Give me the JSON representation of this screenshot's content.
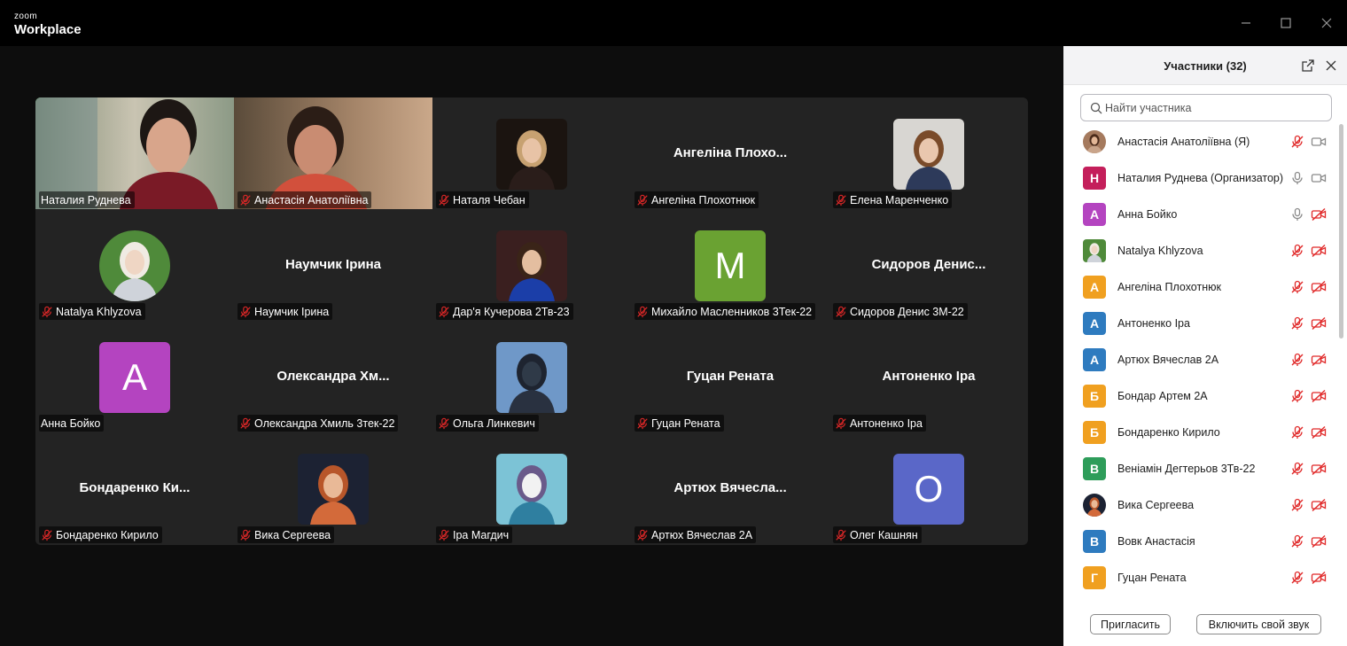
{
  "app": {
    "brand_small": "zoom",
    "brand_big": "Workplace"
  },
  "colors": {
    "active_speaker": "#23d959",
    "muted_red": "#e02828",
    "panel_bg": "#ffffff"
  },
  "tiles": [
    {
      "name": "Наталия Руднева",
      "kind": "video",
      "muted": false,
      "active": true
    },
    {
      "name": "Анастасія Анатоліївна",
      "kind": "video",
      "muted": true
    },
    {
      "name": "Наталя Чебан",
      "kind": "photo",
      "muted": true
    },
    {
      "name": "Ангеліна Плохотнюк",
      "kind": "text",
      "big": "Ангеліна  Плохо...",
      "muted": true
    },
    {
      "name": "Елена Маренченко",
      "kind": "photo",
      "muted": true
    },
    {
      "name": "Natalya Khlyzova",
      "kind": "photo",
      "muted": true
    },
    {
      "name": "Наумчик Ірина",
      "kind": "text",
      "big": "Наумчик Ірина",
      "muted": true
    },
    {
      "name": "Дар'я Кучерова 2Тв-23",
      "kind": "photo",
      "muted": true
    },
    {
      "name": "Михайло Масленников 3Тек-22",
      "kind": "letter",
      "letter": "M",
      "color": "#6aa232",
      "muted": true
    },
    {
      "name": "Сидоров Денис 3М-22",
      "kind": "text",
      "big": "Сидоров  Денис...",
      "muted": true
    },
    {
      "name": "Анна Бойко",
      "kind": "letter",
      "letter": "A",
      "color": "#b444c0",
      "muted": false
    },
    {
      "name": "Олександра Хмиль 3тек-22",
      "kind": "text",
      "big": "Олександра  Хм...",
      "muted": true
    },
    {
      "name": "Ольга Линкевич",
      "kind": "photo",
      "muted": true
    },
    {
      "name": "Гуцан Рената",
      "kind": "text",
      "big": "Гуцан Рената",
      "muted": true
    },
    {
      "name": "Антоненко Іра",
      "kind": "text",
      "big": "Антоненко Іра",
      "muted": true
    },
    {
      "name": "Бондаренко Кирило",
      "kind": "text",
      "big": "Бондаренко  Ки...",
      "muted": true
    },
    {
      "name": "Вика Сергеева",
      "kind": "photo",
      "muted": true
    },
    {
      "name": "Іра Магдич",
      "kind": "photo",
      "muted": true
    },
    {
      "name": "Артюх Вячеслав 2А",
      "kind": "text",
      "big": "Артюх  Вячесла...",
      "muted": true
    },
    {
      "name": "Олег Кашнян",
      "kind": "letter",
      "letter": "O",
      "color": "#5a67c8",
      "muted": true
    }
  ],
  "panel": {
    "title": "Участники (32)",
    "search_placeholder": "Найти участника",
    "invite_label": "Пригласить",
    "unmute_self_label": "Включить свой звук",
    "participants": [
      {
        "name": "Анастасія Анатоліївна (Я)",
        "avatar": "photo",
        "mic": "muted",
        "cam": "on"
      },
      {
        "name": "Наталия Руднева (Организатор)",
        "avatar": "letter",
        "letter": "Н",
        "color": "#c41f5b",
        "mic": "on",
        "cam": "on"
      },
      {
        "name": "Анна Бойко",
        "avatar": "letter",
        "letter": "А",
        "color": "#b444c0",
        "mic": "on",
        "cam": "off"
      },
      {
        "name": "Natalya Khlyzova",
        "avatar": "photo",
        "mic": "muted",
        "cam": "off"
      },
      {
        "name": "Ангеліна Плохотнюк",
        "avatar": "letter",
        "letter": "А",
        "color": "#f0a020",
        "mic": "muted",
        "cam": "off"
      },
      {
        "name": "Антоненко Іра",
        "avatar": "letter",
        "letter": "А",
        "color": "#2e7bbf",
        "mic": "muted",
        "cam": "off"
      },
      {
        "name": "Артюх Вячеслав 2А",
        "avatar": "letter",
        "letter": "А",
        "color": "#2e7bbf",
        "mic": "muted",
        "cam": "off"
      },
      {
        "name": "Бондар Артем 2А",
        "avatar": "letter",
        "letter": "Б",
        "color": "#f0a020",
        "mic": "muted",
        "cam": "off"
      },
      {
        "name": "Бондаренко Кирило",
        "avatar": "letter",
        "letter": "Б",
        "color": "#f0a020",
        "mic": "muted",
        "cam": "off"
      },
      {
        "name": "Веніамін Дегтерьов 3Тв-22",
        "avatar": "letter",
        "letter": "В",
        "color": "#2e9d5a",
        "mic": "muted",
        "cam": "off"
      },
      {
        "name": "Вика Сергеева",
        "avatar": "photo",
        "mic": "muted",
        "cam": "off"
      },
      {
        "name": "Вовк Анастасія",
        "avatar": "letter",
        "letter": "В",
        "color": "#2e7bbf",
        "mic": "muted",
        "cam": "off"
      },
      {
        "name": "Гуцан Рената",
        "avatar": "letter",
        "letter": "Г",
        "color": "#f0a020",
        "mic": "muted",
        "cam": "off"
      }
    ]
  }
}
